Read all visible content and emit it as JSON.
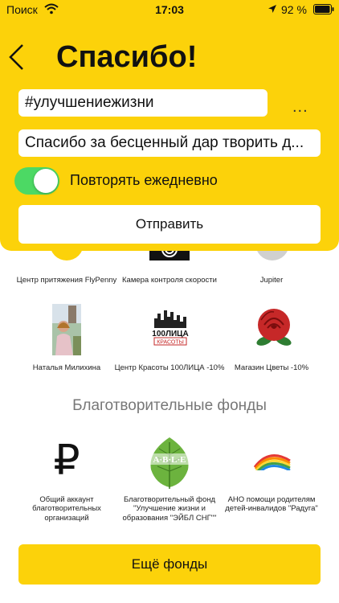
{
  "status_bar": {
    "carrier": "Поиск",
    "time": "17:03",
    "battery": "92 %"
  },
  "header": {
    "title": "Спасибо!",
    "hashtag_value": "#улучшениежизни",
    "more_label": "...",
    "message_value": "Спасибо за бесценный дар творить д...",
    "repeat_label": "Повторять ежедневно",
    "repeat_enabled": true,
    "send_label": "Отправить"
  },
  "partners_row1": [
    {
      "name": "Центр притяжения FlyPenny"
    },
    {
      "name": "Камера контроля скорости"
    },
    {
      "name": "Jupiter"
    }
  ],
  "partners_row2": [
    {
      "name": "Наталья Милихина"
    },
    {
      "name": "Центр Красоты 100ЛИЦА -10%"
    },
    {
      "name": "Магазин Цветы -10%"
    }
  ],
  "charity": {
    "title": "Благотворительные фонды",
    "items": [
      {
        "name": "Общий аккаунт благотворительных организаций"
      },
      {
        "name": "Благотворительный фонд \"Улучшение жизни и образования \"ЭЙБЛ СНГ\"\""
      },
      {
        "name": "АНО помощи родителям детей-инвалидов \"Радуга\""
      }
    ],
    "logo_ruble": "₽",
    "logo_able": "A·B·L·E",
    "logo_100_top": "100ЛИЦА",
    "logo_100_bottom": "КРАСОТЫ"
  },
  "more_funds_label": "Ещё фонды",
  "colors": {
    "accent": "#fcd20a",
    "toggle_on": "#4cd964"
  }
}
